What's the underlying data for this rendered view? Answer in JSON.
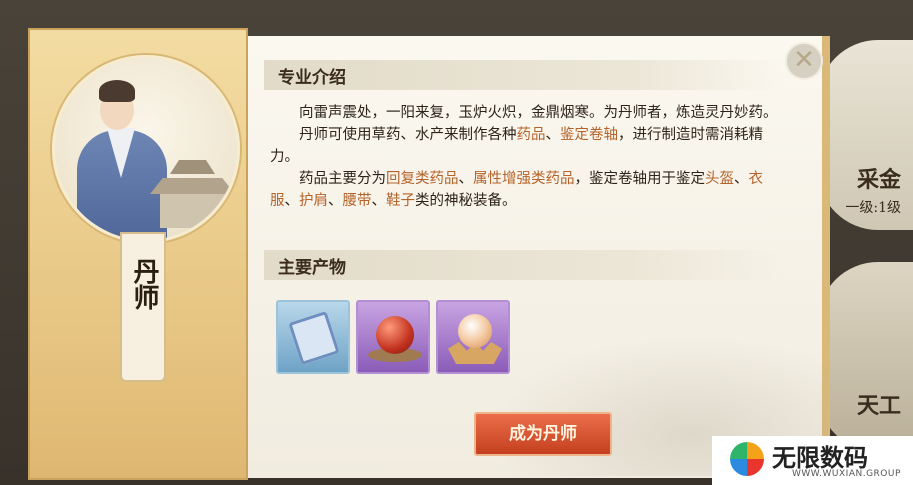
{
  "background": {
    "right_top_label": "采金",
    "right_top_sub": "一级:1级",
    "right_bottom_label": "天工"
  },
  "banner": {
    "profession_name": "丹师"
  },
  "panel": {
    "intro_heading": "专业介绍",
    "intro_paragraphs": [
      [
        {
          "t": "向雷声震处，一阳来复，玉炉火炽，金鼎烟寒。为丹师者，炼造灵丹妙药。"
        }
      ],
      [
        {
          "t": "丹师可使用草药、水产来制作各种"
        },
        {
          "t": "药品",
          "hl": true
        },
        {
          "t": "、"
        },
        {
          "t": "鉴定卷轴",
          "hl": true
        },
        {
          "t": "，进行制造时需消耗精力。"
        }
      ],
      [
        {
          "t": "药品主要分为"
        },
        {
          "t": "回复类药品",
          "hl": true
        },
        {
          "t": "、"
        },
        {
          "t": "属性增强类药品",
          "hl": true
        },
        {
          "t": "，鉴定卷轴用于鉴定"
        },
        {
          "t": "头盔",
          "hl": true
        },
        {
          "t": "、"
        },
        {
          "t": "衣服",
          "hl": true
        },
        {
          "t": "、"
        },
        {
          "t": "护肩",
          "hl": true
        },
        {
          "t": "、"
        },
        {
          "t": "腰带",
          "hl": true
        },
        {
          "t": "、"
        },
        {
          "t": "鞋子",
          "hl": true
        },
        {
          "t": "类的神秘装备。"
        }
      ]
    ],
    "products_heading": "主要产物",
    "products": [
      {
        "icon": "scroll-icon",
        "rarity": "blue"
      },
      {
        "icon": "red-pill-icon",
        "rarity": "purple"
      },
      {
        "icon": "lotus-pearl-icon",
        "rarity": "purple"
      }
    ],
    "become_button": "成为丹师",
    "close_symbol": "✕"
  },
  "watermark": {
    "brand": "无限数码",
    "url": "WWW.WUXIAN.GROUP"
  },
  "colors": {
    "highlight": "#b4632a",
    "button": "#d4502c"
  }
}
